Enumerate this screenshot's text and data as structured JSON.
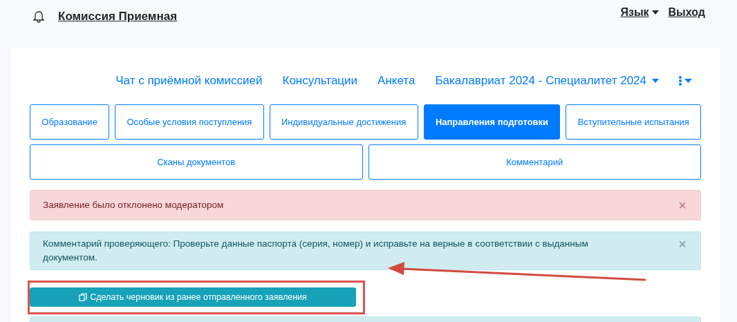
{
  "header": {
    "title": "Комиссия Приемная",
    "language": "Язык",
    "logout": "Выход"
  },
  "nav": {
    "items": [
      {
        "label": "Чат с приёмной комиссией",
        "kind": "link"
      },
      {
        "label": "Консультации",
        "kind": "link"
      },
      {
        "label": "Анкета",
        "kind": "link"
      },
      {
        "label": "Бакалавриат 2024 - Специалитет 2024",
        "kind": "dropdown"
      },
      {
        "kind": "menu"
      }
    ]
  },
  "tab_rows": [
    [
      {
        "label": "Образование",
        "selected": false
      },
      {
        "label": "Особые условия поступления",
        "selected": false
      },
      {
        "label": "Индивидуальные достижения",
        "selected": false
      },
      {
        "label": "Направления подготовки",
        "selected": true
      },
      {
        "label": "Вступительные испытания",
        "selected": false
      }
    ],
    [
      {
        "label": "Сканы документов",
        "selected": false
      },
      {
        "label": "Комментарий",
        "selected": false
      }
    ]
  ],
  "alerts": [
    {
      "kind": "danger",
      "text": "Заявление было отклонено модератором",
      "close": "×"
    },
    {
      "kind": "info",
      "text": "Комментарий проверяющего: Проверьте данные паспорта (серия, номер) и исправьте на верные в соответствии с выданным документом.",
      "close": "×",
      "arrow": true
    }
  ],
  "draft_button": {
    "label": "Сделать черновик из ранее отправленного заявления",
    "highlighted": true
  }
}
